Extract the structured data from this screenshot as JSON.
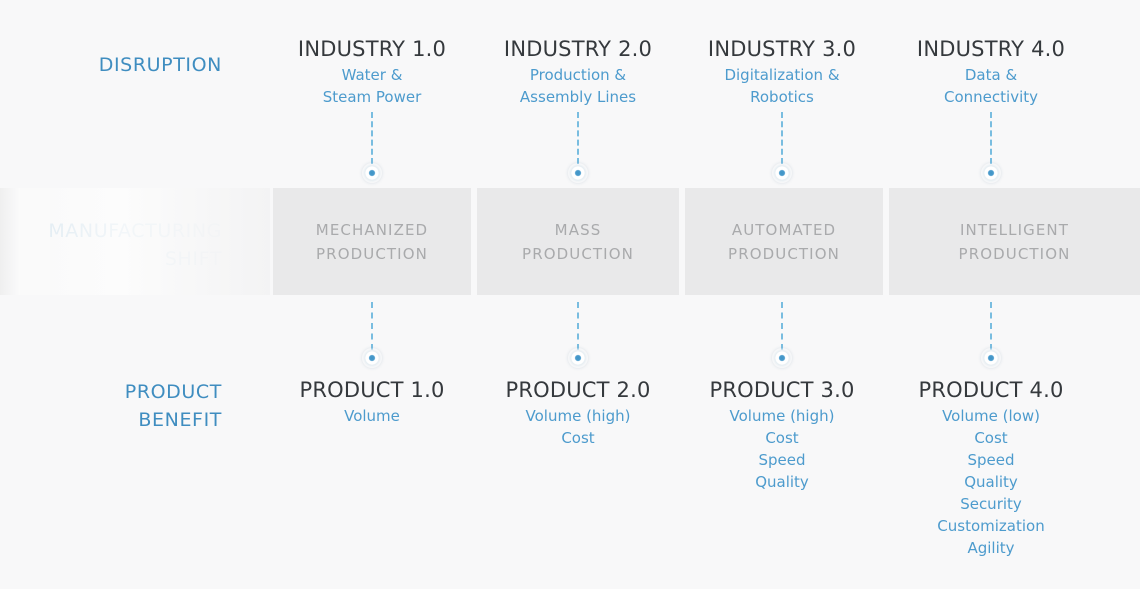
{
  "rows": {
    "disruption_label": "DISRUPTION",
    "shift_label_line1": "MANUFACTURING",
    "shift_label_line2": "SHIFT",
    "benefit_label_line1": "PRODUCT",
    "benefit_label_line2": "BENEFIT"
  },
  "colors": {
    "accent_blue": "#4d9bcd",
    "label_blue": "#3f8dc0",
    "title_dark": "#35393d",
    "band_grey": "#e9e9ea",
    "band_text_grey": "#a9aaac",
    "page_bg": "#f8f8f9",
    "dash_blue": "#79bde0"
  },
  "columns": [
    {
      "disruption_title": "INDUSTRY 1.0",
      "disruption_sub": [
        "Water &",
        "Steam Power"
      ],
      "shift": [
        "MECHANIZED",
        "PRODUCTION"
      ],
      "product_title": "PRODUCT 1.0",
      "benefits": [
        "Volume"
      ]
    },
    {
      "disruption_title": "INDUSTRY 2.0",
      "disruption_sub": [
        "Production &",
        "Assembly Lines"
      ],
      "shift": [
        "MASS",
        "PRODUCTION"
      ],
      "product_title": "PRODUCT 2.0",
      "benefits": [
        "Volume (high)",
        "Cost"
      ]
    },
    {
      "disruption_title": "INDUSTRY 3.0",
      "disruption_sub": [
        "Digitalization &",
        "Robotics"
      ],
      "shift": [
        "AUTOMATED",
        "PRODUCTION"
      ],
      "product_title": "PRODUCT 3.0",
      "benefits": [
        "Volume (high)",
        "Cost",
        "Speed",
        "Quality"
      ]
    },
    {
      "disruption_title": "INDUSTRY 4.0",
      "disruption_sub": [
        "Data &",
        "Connectivity"
      ],
      "shift": [
        "INTELLIGENT",
        "PRODUCTION"
      ],
      "product_title": "PRODUCT 4.0",
      "benefits": [
        "Volume (low)",
        "Cost",
        "Speed",
        "Quality",
        "Security",
        "Customization",
        "Agility"
      ]
    }
  ]
}
